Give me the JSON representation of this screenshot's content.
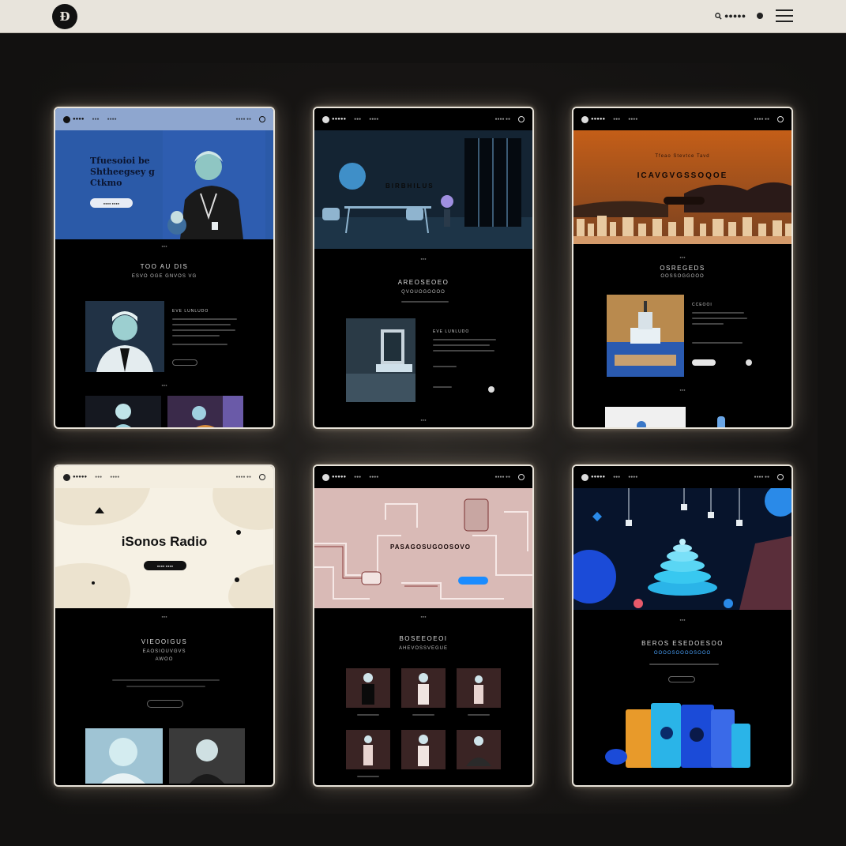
{
  "topbar": {
    "logo_text": "Ð",
    "search_label": "●●●●●",
    "search_icon": "search-icon",
    "menu_icon": "hamburger-menu-icon"
  },
  "cards": [
    {
      "brand": "●●●●",
      "nav": [
        "●●●",
        "●●●●",
        "●●●● ●●"
      ],
      "hero_title": "Tfuesoioi be\nShtheegsey g\nCtkmo",
      "hero_button": "●●●● ●●●●",
      "section_title": "TOO AU DIS",
      "section_sub": "ESVO OGE GNVOS VG",
      "article_title": "EVE LUNLUDO"
    },
    {
      "brand": "●●●●●",
      "nav": [
        "●●●",
        "●●●●",
        "●●●● ●●"
      ],
      "hero_title": "BIRBHILUS",
      "section_title": "AREOSEOEO",
      "section_sub": "QVOUOGOOOO",
      "article_title": "EVE LUNLUDO"
    },
    {
      "brand": "●●●●●",
      "nav": [
        "●●●",
        "●●●●",
        "●●●● ●●"
      ],
      "hero_kicker": "Tfeao Stevtce Tavd",
      "hero_title": "ICAVGVGSSOQOE",
      "section_title": "OSREGEDS",
      "section_sub": "OOSSOGGOOO",
      "article_title": "CCEOOI"
    },
    {
      "brand": "●●●●●",
      "nav": [
        "●●●",
        "●●●●",
        "●●●● ●●"
      ],
      "hero_title": "iSonos Radio",
      "hero_button": "●●●● ●●●●",
      "section_title": "VIEOOIGUS",
      "section_sub": "EAOSIOUVGVS",
      "section_sub2": "AWOO"
    },
    {
      "brand": "●●●●●",
      "nav": [
        "●●●",
        "●●●●",
        "●●●● ●●"
      ],
      "hero_title": "PASAGOSUGOOSOVO",
      "section_title": "BOSEEOEOI",
      "section_sub": "AHEVOSSVEGUE"
    },
    {
      "brand": "●●●●●",
      "nav": [
        "●●●",
        "●●●●",
        "●●●● ●●"
      ],
      "section_title": "BEROS ESEDOESOO",
      "section_sub": "OOOOSOOOOSOOO"
    }
  ],
  "colors": {
    "topbar": "#e8e4dc",
    "background": "#121110",
    "card_border": "#e9e4da",
    "blue_hero": "#2b5aa8",
    "orange_hero": "#c86a22",
    "pink_hero": "#d8b6b2",
    "cream_hero": "#f4eee0",
    "accent_blue": "#1b8cff"
  }
}
